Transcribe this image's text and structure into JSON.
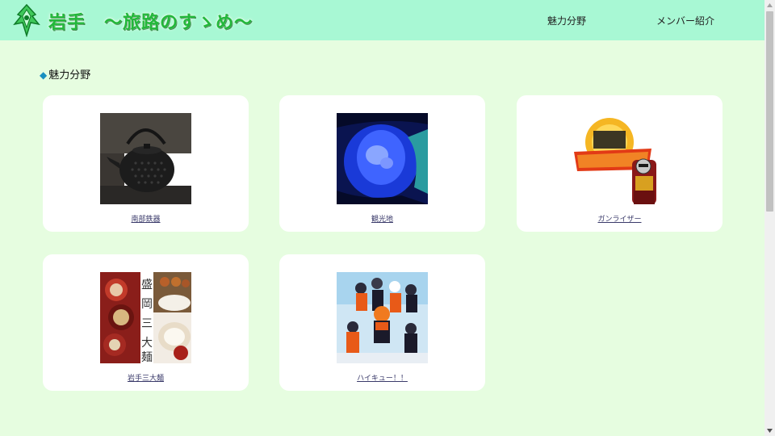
{
  "header": {
    "title": "岩手　～旅路のすゝめ～",
    "nav": [
      "魅力分野",
      "メンバー紹介"
    ]
  },
  "section": {
    "heading": "魅力分野"
  },
  "cards": [
    {
      "label": "南部鉄器",
      "image": "iron-teapot"
    },
    {
      "label": "観光地",
      "image": "blue-cave-water"
    },
    {
      "label": "ガンライザー",
      "image": "hero-logo"
    },
    {
      "label": "岩手三大麺",
      "image": "noodle-dishes"
    },
    {
      "label": "ハイキュー！！",
      "image": "anime-volleyball"
    }
  ],
  "colors": {
    "header_bg": "#a8f8d4",
    "page_bg": "#e6fde0",
    "title_green": "#22b83a",
    "accent_blue": "#1a8fc0"
  }
}
